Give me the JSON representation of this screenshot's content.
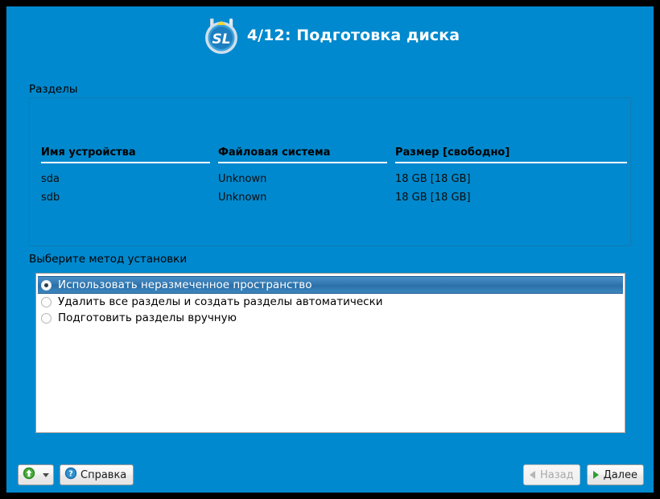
{
  "window": {
    "background_color": "#0089ce",
    "border_color": "#000000"
  },
  "header": {
    "logo_icon": "salix-sl-plate-logo",
    "title": "4/12: Подготовка диска",
    "step_current": 4,
    "step_total": 12,
    "title_color": "#ffffff"
  },
  "partitions": {
    "label": "Разделы",
    "columns": [
      "Имя устройства",
      "Файловая система",
      "Размер [свободно]"
    ],
    "rows": [
      {
        "device": "sda",
        "filesystem": "Unknown",
        "size": "18 GB [18 GB]"
      },
      {
        "device": "sdb",
        "filesystem": "Unknown",
        "size": "18 GB [18 GB]"
      }
    ]
  },
  "method": {
    "label": "Выберите метод установки",
    "options": [
      {
        "label": "Использовать неразмеченное пространство",
        "selected": true
      },
      {
        "label": "Удалить все разделы и создать разделы автоматически",
        "selected": false
      },
      {
        "label": "Подготовить разделы вручную",
        "selected": false
      }
    ],
    "selected_background_color": "#2f74ad",
    "selected_text_color": "#ffffff"
  },
  "toolbar": {
    "upload_button": {
      "icon": "green-up-arrow-icon",
      "label": "",
      "dropdown_icon": "chevron-down-icon"
    },
    "help_button": {
      "icon": "blue-question-mark-icon",
      "label": "Справка"
    }
  },
  "navigation": {
    "back_button": {
      "label": "Назад",
      "icon": "arrow-left-icon",
      "disabled": true
    },
    "next_button": {
      "label": "Далее",
      "icon": "arrow-right-icon",
      "disabled": false
    }
  }
}
